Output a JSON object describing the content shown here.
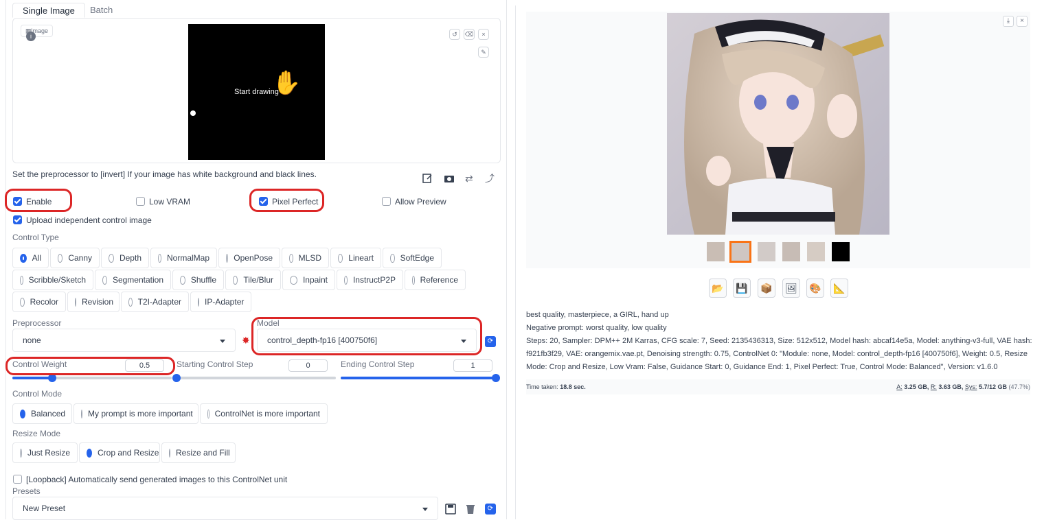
{
  "tabs": [
    "Single Image",
    "Batch"
  ],
  "canvas": {
    "image_label": "Image",
    "hint": "Start drawing"
  },
  "hint_text": "Set the preprocessor to [invert] If your image has white background and black lines.",
  "checkboxes": {
    "enable": "Enable",
    "low_vram": "Low VRAM",
    "pixel_perfect": "Pixel Perfect",
    "allow_preview": "Allow Preview",
    "upload_independent": "Upload independent control image",
    "loopback": "[Loopback] Automatically send generated images to this ControlNet unit"
  },
  "control_type": {
    "label": "Control Type",
    "row1": [
      "All",
      "Canny",
      "Depth",
      "NormalMap",
      "OpenPose",
      "MLSD",
      "Lineart",
      "SoftEdge"
    ],
    "row2": [
      "Scribble/Sketch",
      "Segmentation",
      "Shuffle",
      "Tile/Blur",
      "Inpaint",
      "InstructP2P",
      "Reference"
    ],
    "row3": [
      "Recolor",
      "Revision",
      "T2I-Adapter",
      "IP-Adapter"
    ],
    "selected": "All"
  },
  "preprocessor": {
    "label": "Preprocessor",
    "value": "none"
  },
  "model": {
    "label": "Model",
    "value": "control_depth-fp16 [400750f6]"
  },
  "sliders": {
    "weight_label": "Control Weight",
    "weight_value": "0.5",
    "start_label": "Starting Control Step",
    "start_value": "0",
    "end_label": "Ending Control Step",
    "end_value": "1",
    "weight_fraction": 0.25,
    "start_fraction": 0.0,
    "end_fraction": 1.0
  },
  "control_mode": {
    "label": "Control Mode",
    "options": [
      "Balanced",
      "My prompt is more important",
      "ControlNet is more important"
    ],
    "selected": "Balanced"
  },
  "resize_mode": {
    "label": "Resize Mode",
    "options": [
      "Just Resize",
      "Crop and Resize",
      "Resize and Fill"
    ],
    "selected": "Crop and Resize"
  },
  "presets": {
    "label": "Presets",
    "value": "New Preset"
  },
  "output": {
    "prompt": "best quality, masterpiece, a GIRL, hand up",
    "negative": "Negative prompt: worst quality, low quality",
    "params1": "Steps: 20, Sampler: DPM++ 2M Karras, CFG scale: 7, Seed: 2135436313, Size: 512x512, Model hash: abcaf14e5a, Model: anything-v3-full, VAE hash:",
    "params2": "f921fb3f29, VAE: orangemix.vae.pt, Denoising strength: 0.75, ControlNet 0: \"Module: none, Model: control_depth-fp16 [400750f6], Weight: 0.5, Resize",
    "params3": "Mode: Crop and Resize, Low Vram: False, Guidance Start: 0, Guidance End: 1, Pixel Perfect: True, Control Mode: Balanced\", Version: v1.6.0",
    "time_label": "Time taken:",
    "time_value": "18.8 sec.",
    "mem_a_label": "A:",
    "mem_a": "3.25 GB,",
    "mem_r_label": "R:",
    "mem_r": "3.63 GB,",
    "mem_sys_label": "Sys:",
    "mem_sys": "5.7/12 GB",
    "mem_pct": "(47.7%)"
  },
  "colors": {
    "accent": "#2563eb",
    "highlight": "#dc2626",
    "selected_thumb": "#f97316"
  }
}
